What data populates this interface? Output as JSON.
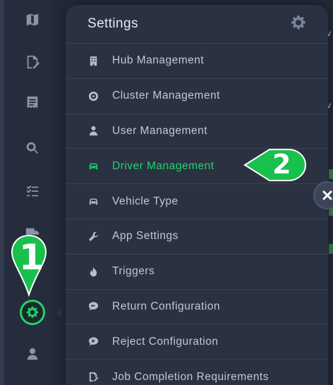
{
  "sidebar": {
    "icons": [
      "map-icon",
      "document-edit-icon",
      "list-document-icon",
      "search-icon",
      "checklist-icon",
      "truck-icon",
      "settings-gear-icon",
      "user-icon"
    ],
    "active": "settings-gear-icon"
  },
  "settings_panel": {
    "title": "Settings",
    "items": [
      {
        "label": "Hub Management",
        "icon": "building-icon"
      },
      {
        "label": "Cluster Management",
        "icon": "cluster-icon"
      },
      {
        "label": "User Management",
        "icon": "user-icon"
      },
      {
        "label": "Driver Management",
        "icon": "car-icon",
        "active": true
      },
      {
        "label": "Vehicle Type",
        "icon": "car-icon"
      },
      {
        "label": "App Settings",
        "icon": "wrench-icon"
      },
      {
        "label": "Triggers",
        "icon": "flame-icon"
      },
      {
        "label": "Return Configuration",
        "icon": "chat-return-icon"
      },
      {
        "label": "Reject Configuration",
        "icon": "chat-reject-icon"
      },
      {
        "label": "Job Completion Requirements",
        "icon": "document-edit-icon"
      }
    ]
  },
  "callouts": {
    "one": "1",
    "two": "2"
  },
  "colors": {
    "accent": "#20d36b",
    "panel": "#2a3242",
    "sidebar": "#252c3b",
    "background": "#1f2533"
  }
}
